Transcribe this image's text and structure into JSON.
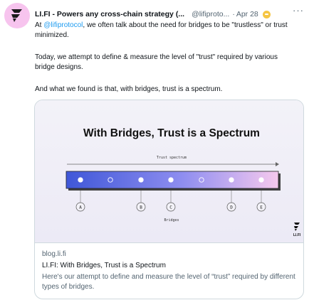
{
  "tweet": {
    "author_name": "LI.FI - Powers any cross-chain strategy (...",
    "handle": "@lifiproto...",
    "separator": "·",
    "date": "Apr 28",
    "more_icon": "more-icon",
    "paragraph1_prefix": "At ",
    "mention": "@lifiprotocol",
    "paragraph1_suffix": ", we often talk about the need for bridges to be \"trustless\" or trust minimized.",
    "paragraph2": "Today, we attempt to define & measure the level of \"trust\" required by various bridge designs.",
    "paragraph3": "And what we found is that, with bridges, trust is a spectrum."
  },
  "card": {
    "image": {
      "title": "With Bridges, Trust is a Spectrum",
      "spectrum_label": "Trust spectrum",
      "bridges_label": "Bridges",
      "markers": [
        "A",
        "B",
        "C",
        "D",
        "E"
      ],
      "logo_text": "LI.FI",
      "colors": {
        "bar_start": "#3f57d8",
        "bar_end": "#f6c9ee",
        "accent": "#7b8ce6"
      }
    },
    "domain": "blog.li.fi",
    "title": "LI.FI: With Bridges, Trust is a Spectrum",
    "description": "Here's our attempt to define and measure the level of “trust” required by different types of bridges."
  },
  "colors": {
    "link": "#1d9bf0",
    "avatar_bg": "#f7c4ee",
    "secondary_text": "#536471",
    "border": "#cfd9de"
  }
}
